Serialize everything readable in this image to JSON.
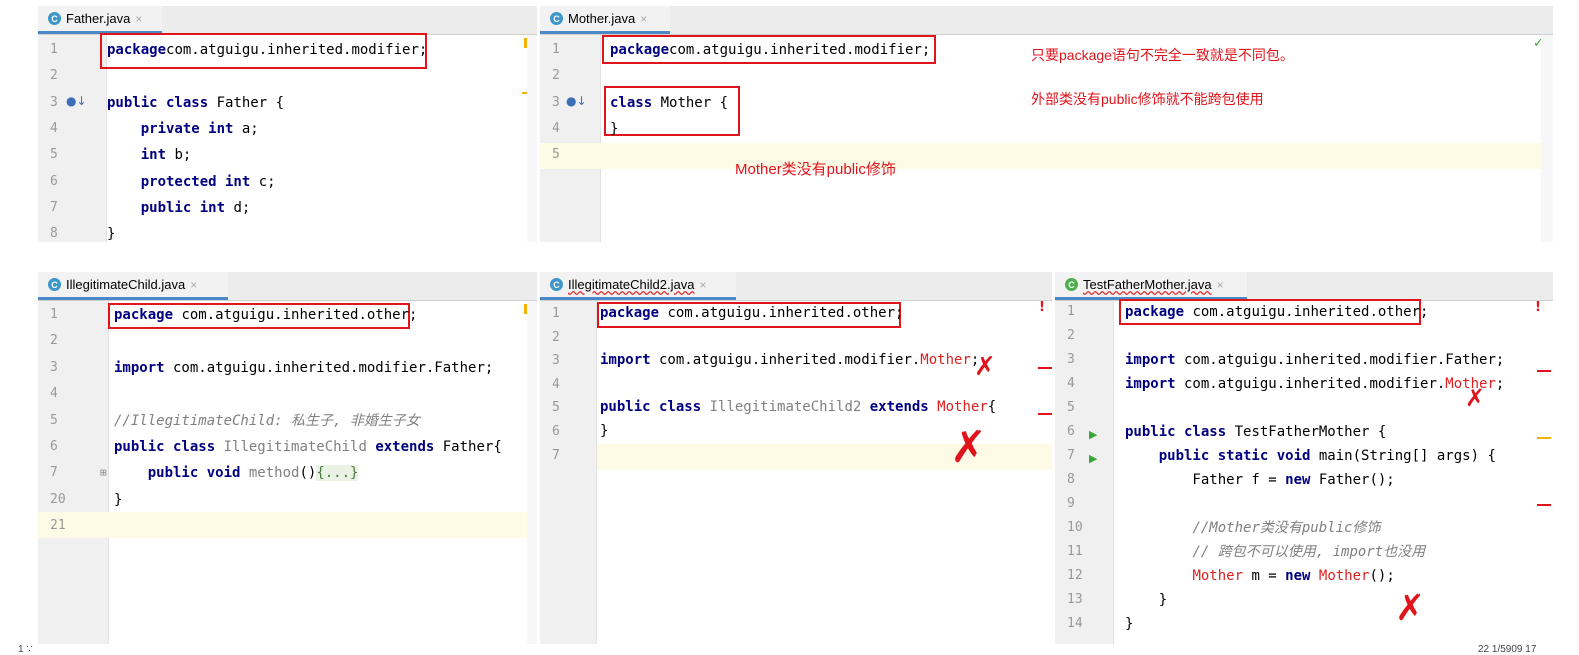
{
  "panes": {
    "father": {
      "tab": "Father.java",
      "lines": [
        {
          "n": "1",
          "parts": [
            [
              "kw",
              "package"
            ],
            [
              "",
              "com.atguigu.inherited.modifier;"
            ]
          ]
        },
        {
          "n": "2",
          "parts": []
        },
        {
          "n": "3",
          "parts": [
            [
              "kw",
              "public class"
            ],
            [
              "",
              " Father {"
            ]
          ]
        },
        {
          "n": "4",
          "parts": [
            [
              "",
              "    "
            ],
            [
              "kw",
              "private int"
            ],
            [
              "",
              " a;"
            ]
          ]
        },
        {
          "n": "5",
          "parts": [
            [
              "",
              "    "
            ],
            [
              "kw",
              "int"
            ],
            [
              "",
              " b;"
            ]
          ]
        },
        {
          "n": "6",
          "parts": [
            [
              "",
              "    "
            ],
            [
              "kw",
              "protected int"
            ],
            [
              "",
              " c;"
            ]
          ]
        },
        {
          "n": "7",
          "parts": [
            [
              "",
              "    "
            ],
            [
              "kw",
              "public int"
            ],
            [
              "",
              " d;"
            ]
          ]
        },
        {
          "n": "8",
          "parts": [
            [
              "",
              "}"
            ]
          ]
        }
      ]
    },
    "mother": {
      "tab": "Mother.java",
      "lines": [
        {
          "n": "1",
          "parts": [
            [
              "kw",
              "package"
            ],
            [
              "",
              "com.atguigu.inherited.modifier;"
            ]
          ]
        },
        {
          "n": "2",
          "parts": []
        },
        {
          "n": "3",
          "parts": [
            [
              "kw",
              "class"
            ],
            [
              "",
              " Mother {"
            ]
          ]
        },
        {
          "n": "4",
          "parts": [
            [
              "",
              "}"
            ]
          ]
        },
        {
          "n": "5",
          "parts": []
        }
      ],
      "notes": {
        "note1": "只要package语句不完全一致就是不同包。",
        "note2": "外部类没有public修饰就不能跨包使用",
        "note3": "Mother类没有public修饰"
      }
    },
    "illegit": {
      "tab": "IllegitimateChild.java",
      "lines": [
        {
          "n": "1",
          "parts": [
            [
              "kw",
              "package"
            ],
            [
              "",
              " com.atguigu.inherited.other;"
            ]
          ]
        },
        {
          "n": "2",
          "parts": []
        },
        {
          "n": "3",
          "parts": [
            [
              "kw",
              "import"
            ],
            [
              "",
              " com.atguigu.inherited.modifier.Father;"
            ]
          ]
        },
        {
          "n": "4",
          "parts": []
        },
        {
          "n": "5",
          "parts": [
            [
              "cmt",
              "//IllegitimateChild: 私生子, 非婚生子女"
            ]
          ]
        },
        {
          "n": "6",
          "parts": [
            [
              "kw",
              "public class"
            ],
            [
              "gray",
              " IllegitimateChild "
            ],
            [
              "kw",
              "extends"
            ],
            [
              "",
              " Father{"
            ]
          ]
        },
        {
          "n": "7",
          "parts": [
            [
              "",
              "    "
            ],
            [
              "kw",
              "public void"
            ],
            [
              "gray",
              " method"
            ],
            [
              "",
              "()"
            ],
            [
              "fold",
              "{...}"
            ]
          ]
        },
        {
          "n": "20",
          "parts": [
            [
              "",
              "}"
            ]
          ]
        },
        {
          "n": "21",
          "parts": []
        }
      ]
    },
    "illegit2": {
      "tab": "IllegitimateChild2.java",
      "lines": [
        {
          "n": "1",
          "parts": [
            [
              "kw",
              "package"
            ],
            [
              "",
              " com.atguigu.inherited.other;"
            ]
          ]
        },
        {
          "n": "2",
          "parts": []
        },
        {
          "n": "3",
          "parts": [
            [
              "kw",
              "import"
            ],
            [
              "",
              " com.atguigu.inherited.modifier."
            ],
            [
              "ref",
              "Mother"
            ],
            [
              "",
              ";"
            ]
          ]
        },
        {
          "n": "4",
          "parts": []
        },
        {
          "n": "5",
          "parts": [
            [
              "kw",
              "public class"
            ],
            [
              "gray",
              " IllegitimateChild2 "
            ],
            [
              "kw",
              "extends"
            ],
            [
              "ref",
              " Mother"
            ],
            [
              "",
              "{"
            ]
          ]
        },
        {
          "n": "6",
          "parts": [
            [
              "",
              "}"
            ]
          ]
        },
        {
          "n": "7",
          "parts": []
        }
      ]
    },
    "test": {
      "tab": "TestFatherMother.java",
      "lines": [
        {
          "n": "1",
          "parts": [
            [
              "kw",
              "package"
            ],
            [
              "",
              " com.atguigu.inherited.other;"
            ]
          ]
        },
        {
          "n": "2",
          "parts": []
        },
        {
          "n": "3",
          "parts": [
            [
              "kw",
              "import"
            ],
            [
              "",
              " com.atguigu.inherited.modifier.Father;"
            ]
          ]
        },
        {
          "n": "4",
          "parts": [
            [
              "kw",
              "import"
            ],
            [
              "",
              " com.atguigu.inherited.modifier."
            ],
            [
              "ref",
              "Mother"
            ],
            [
              "",
              ";"
            ]
          ]
        },
        {
          "n": "5",
          "parts": []
        },
        {
          "n": "6",
          "parts": [
            [
              "kw",
              "public class"
            ],
            [
              "",
              " TestFatherMother {"
            ]
          ]
        },
        {
          "n": "7",
          "parts": [
            [
              "",
              "    "
            ],
            [
              "kw",
              "public static void"
            ],
            [
              "",
              " main(String[] args) {"
            ]
          ]
        },
        {
          "n": "8",
          "parts": [
            [
              "",
              "        Father f = "
            ],
            [
              "kw",
              "new"
            ],
            [
              "",
              " Father();"
            ]
          ]
        },
        {
          "n": "9",
          "parts": []
        },
        {
          "n": "10",
          "parts": [
            [
              "",
              "        "
            ],
            [
              "cmt",
              "//Mother类没有public修饰"
            ]
          ]
        },
        {
          "n": "11",
          "parts": [
            [
              "",
              "        "
            ],
            [
              "cmt",
              "// 跨包不可以使用, import也没用"
            ]
          ]
        },
        {
          "n": "12",
          "parts": [
            [
              "",
              "        "
            ],
            [
              "ref",
              "Mother"
            ],
            [
              "",
              " m = "
            ],
            [
              "kw",
              "new"
            ],
            [
              "ref",
              " Mother"
            ],
            [
              "",
              "();"
            ]
          ]
        },
        {
          "n": "13",
          "parts": [
            [
              "",
              "    }"
            ]
          ]
        },
        {
          "n": "14",
          "parts": [
            [
              "",
              "}"
            ]
          ]
        }
      ]
    }
  },
  "icons": {
    "class_icon": "C",
    "close_icon": "×",
    "error_icon": "!",
    "check_icon": "✓",
    "run_icon": "▶",
    "x_mark": "✗"
  },
  "statusbar": {
    "left": "1 ∵",
    "right": "22 1/5909 17"
  },
  "colors": {
    "annotation_red": "#e0141b",
    "keyword": "#000080",
    "tab_underline": "#4a88c7"
  }
}
